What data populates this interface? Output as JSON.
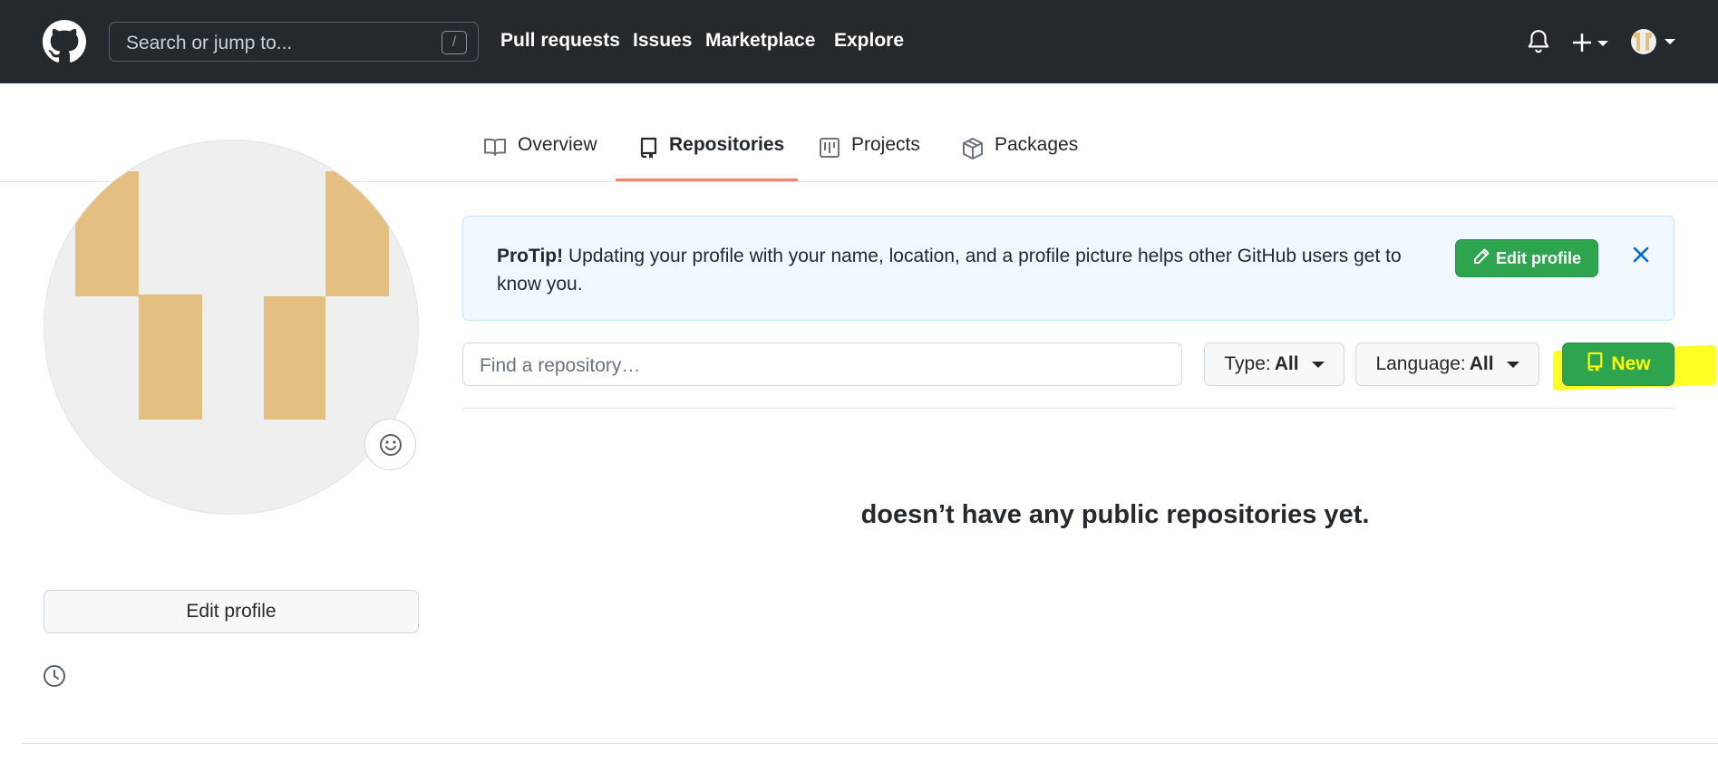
{
  "header": {
    "search_placeholder": "Search or jump to...",
    "search_shortcut": "/",
    "nav": [
      "Pull requests",
      "Issues",
      "Marketplace",
      "Explore"
    ],
    "icons": [
      "github-logo",
      "bell-icon",
      "plus-icon",
      "avatar"
    ]
  },
  "tabs": [
    {
      "label": "Overview",
      "icon": "book-icon",
      "active": false
    },
    {
      "label": "Repositories",
      "icon": "repo-icon",
      "active": true
    },
    {
      "label": "Projects",
      "icon": "project-icon",
      "active": false
    },
    {
      "label": "Packages",
      "icon": "package-icon",
      "active": false
    }
  ],
  "sidebar": {
    "edit_profile_label": "Edit profile"
  },
  "protip": {
    "lead": "ProTip!",
    "text": " Updating your profile with your name, location, and a profile picture helps other GitHub users get to know you.",
    "button_label": "Edit profile"
  },
  "filters": {
    "search_placeholder": "Find a repository…",
    "type_label": "Type:",
    "type_value": "All",
    "language_label": "Language:",
    "language_value": "All",
    "new_label": "New"
  },
  "empty_state": {
    "message": "doesn’t have any public repositories yet."
  },
  "colors": {
    "header_bg": "#24292e",
    "primary_green": "#2ea44f",
    "active_tab_border": "#f9826c",
    "protip_bg": "#f1f8ff",
    "avatar_tan": "#e3bf82",
    "highlight": "#ffff00"
  }
}
